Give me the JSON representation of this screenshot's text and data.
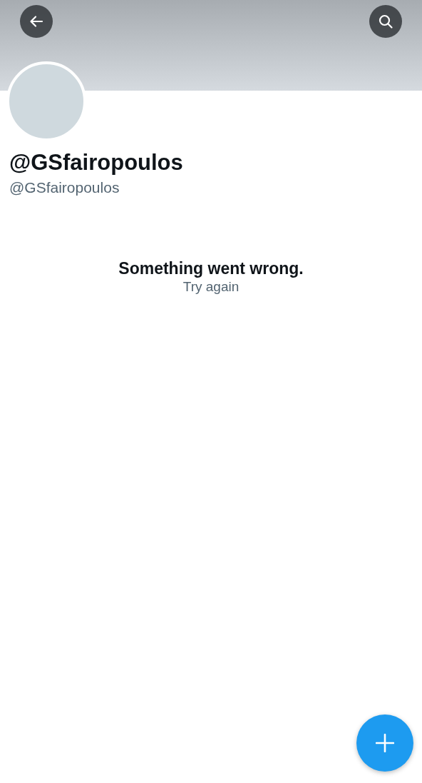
{
  "profile": {
    "display_name": "@GSfairopoulos",
    "handle": "@GSfairopoulos"
  },
  "error": {
    "title": "Something went wrong.",
    "action": "Try again"
  }
}
